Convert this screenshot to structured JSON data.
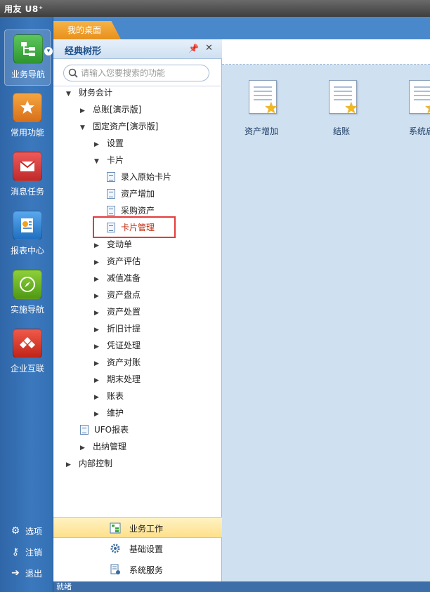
{
  "app": {
    "title": "用友 U8⁺"
  },
  "rail": {
    "items": [
      {
        "label": "业务导航",
        "icon": "tree-nav-icon",
        "color": "#3aa83a"
      },
      {
        "label": "常用功能",
        "icon": "star-folder-icon",
        "color": "#e8841a"
      },
      {
        "label": "消息任务",
        "icon": "mail-icon",
        "color": "#d63a3a"
      },
      {
        "label": "报表中心",
        "icon": "report-icon",
        "color": "#2f86d6"
      },
      {
        "label": "实施导航",
        "icon": "compass-icon",
        "color": "#6aae1e"
      },
      {
        "label": "企业互联",
        "icon": "connect-icon",
        "color": "#d8342a"
      }
    ],
    "bottom": [
      {
        "label": "选项",
        "icon": "gear-icon"
      },
      {
        "label": "注销",
        "icon": "key-icon"
      },
      {
        "label": "退出",
        "icon": "exit-icon"
      }
    ]
  },
  "tabs": [
    {
      "label": "我的桌面"
    }
  ],
  "panel": {
    "title": "经典树形",
    "search_placeholder": "请输入您要搜索的功能",
    "tree": [
      {
        "label": "财务会计",
        "level": 0,
        "state": "open"
      },
      {
        "label": "总账[演示版]",
        "level": 1,
        "state": "closed"
      },
      {
        "label": "固定资产[演示版]",
        "level": 1,
        "state": "open"
      },
      {
        "label": "设置",
        "level": 2,
        "state": "closed"
      },
      {
        "label": "卡片",
        "level": 2,
        "state": "open"
      },
      {
        "label": "录入原始卡片",
        "level": 3,
        "state": "leaf"
      },
      {
        "label": "资产增加",
        "level": 3,
        "state": "leaf"
      },
      {
        "label": "采购资产",
        "level": 3,
        "state": "leaf"
      },
      {
        "label": "卡片管理",
        "level": 3,
        "state": "leaf",
        "highlight": true
      },
      {
        "label": "变动单",
        "level": 2,
        "state": "closed"
      },
      {
        "label": "资产评估",
        "level": 2,
        "state": "closed"
      },
      {
        "label": "减值准备",
        "level": 2,
        "state": "closed"
      },
      {
        "label": "资产盘点",
        "level": 2,
        "state": "closed"
      },
      {
        "label": "资产处置",
        "level": 2,
        "state": "closed"
      },
      {
        "label": "折旧计提",
        "level": 2,
        "state": "closed"
      },
      {
        "label": "凭证处理",
        "level": 2,
        "state": "closed"
      },
      {
        "label": "资产对账",
        "level": 2,
        "state": "closed"
      },
      {
        "label": "期末处理",
        "level": 2,
        "state": "closed"
      },
      {
        "label": "账表",
        "level": 2,
        "state": "closed"
      },
      {
        "label": "维护",
        "level": 2,
        "state": "closed"
      },
      {
        "label": "UFO报表",
        "level": 1,
        "state": "leaf"
      },
      {
        "label": "出纳管理",
        "level": 1,
        "state": "closed"
      },
      {
        "label": "内部控制",
        "level": 0,
        "state": "closed"
      }
    ],
    "nav": [
      {
        "label": "业务工作",
        "icon": "business-work-icon",
        "active": true
      },
      {
        "label": "基础设置",
        "icon": "gear-icon",
        "active": false
      },
      {
        "label": "系统服务",
        "icon": "system-service-icon",
        "active": false
      }
    ]
  },
  "desktop": {
    "shortcuts": [
      {
        "label": "资产增加"
      },
      {
        "label": "结账"
      },
      {
        "label": "系统启"
      }
    ]
  },
  "status": {
    "text": "就绪"
  }
}
